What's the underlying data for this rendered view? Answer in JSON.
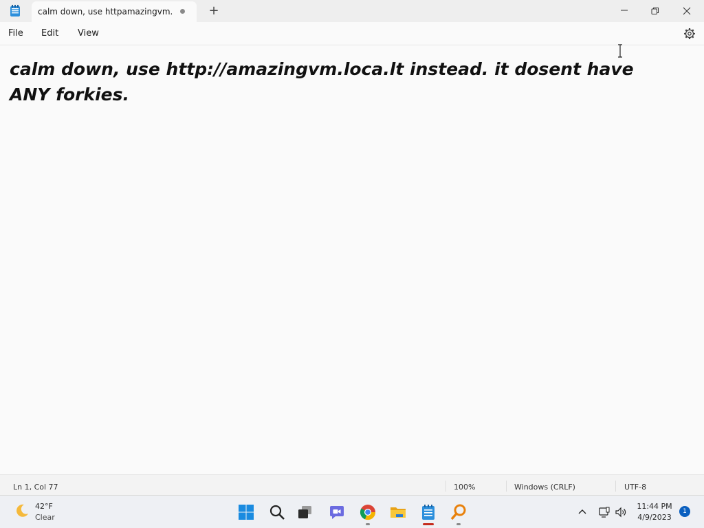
{
  "window": {
    "tab_title": "calm down, use httpamazingvm.loc",
    "new_tab_label": "+"
  },
  "menu": {
    "file": "File",
    "edit": "Edit",
    "view": "View"
  },
  "editor": {
    "text": "calm down, use http://amazingvm.loca.lt instead. it dosent have ANY forkies."
  },
  "status": {
    "position": "Ln 1, Col 77",
    "zoom": "100%",
    "line_ending": "Windows (CRLF)",
    "encoding": "UTF-8"
  },
  "taskbar": {
    "weather": {
      "temp": "42°F",
      "condition": "Clear"
    },
    "clock": {
      "time": "11:44 PM",
      "date": "4/9/2023"
    },
    "notification_count": "1",
    "apps": [
      "start-icon",
      "search-icon",
      "task-view-icon",
      "chat-icon",
      "chrome-icon",
      "file-explorer-icon",
      "notepad-icon",
      "magnifier-icon"
    ]
  },
  "colors": {
    "accent": "#0a5fbf",
    "notepad_blue": "#2c8fdc",
    "active_indicator": "#c42b1c"
  }
}
